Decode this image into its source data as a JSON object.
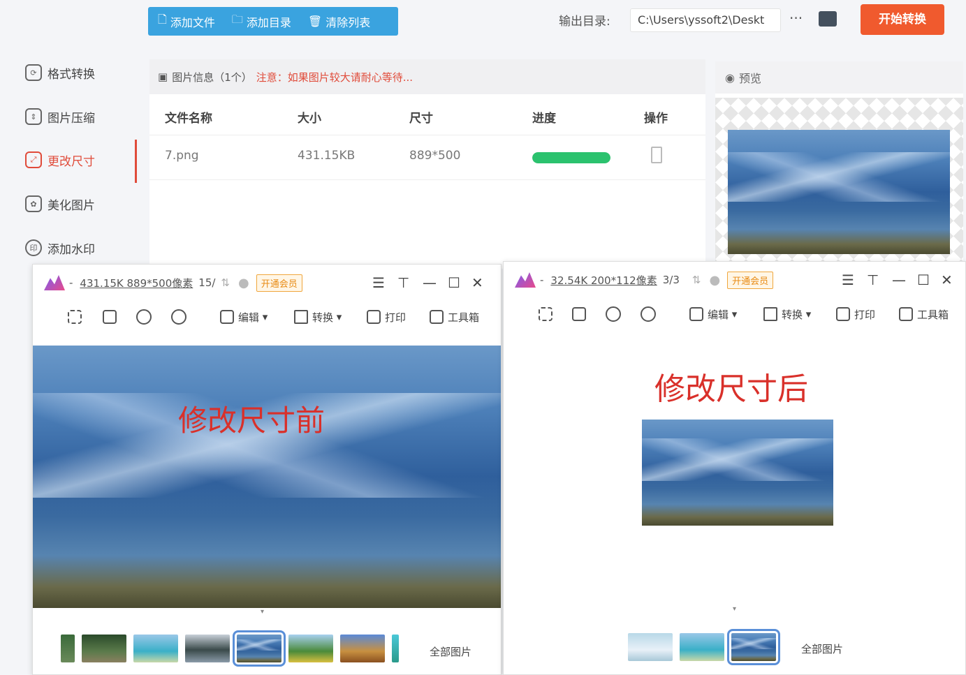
{
  "toolbar": {
    "add_file": "添加文件",
    "add_dir": "添加目录",
    "clear_list": "清除列表",
    "output_label": "输出目录:",
    "output_path": "C:\\Users\\yssoft2\\Deskt",
    "more": "···",
    "start": "开始转换"
  },
  "sidebar": {
    "items": [
      {
        "label": "格式转换",
        "icon": "format-convert-icon"
      },
      {
        "label": "图片压缩",
        "icon": "compress-icon"
      },
      {
        "label": "更改尺寸",
        "icon": "resize-icon"
      },
      {
        "label": "美化图片",
        "icon": "beautify-icon"
      },
      {
        "label": "添加水印",
        "icon": "watermark-icon"
      }
    ],
    "active_index": 2
  },
  "file_panel": {
    "header": "图片信息（1个）",
    "warn": "注意：如果图片较大请耐心等待...",
    "columns": [
      "文件名称",
      "大小",
      "尺寸",
      "进度",
      "操作"
    ],
    "rows": [
      {
        "name": "7.png",
        "size": "431.15KB",
        "dims": "889*500",
        "progress": 1.0
      }
    ]
  },
  "preview": {
    "title": "预览"
  },
  "viewer_left": {
    "dash": "-",
    "info": "431.15K 889*500像素",
    "count": "15/",
    "vip": "开通会员",
    "tools": {
      "edit": "编辑",
      "convert": "转换",
      "print": "打印",
      "toolbox": "工具箱"
    },
    "caption": "修改尺寸前",
    "all_images": "全部图片"
  },
  "viewer_right": {
    "dash": "-",
    "info": "32.54K 200*112像素",
    "count": "3/3",
    "vip": "开通会员",
    "tools": {
      "edit": "编辑",
      "convert": "转换",
      "print": "打印",
      "toolbox": "工具箱"
    },
    "caption": "修改尺寸后",
    "all_images": "全部图片"
  },
  "colors": {
    "accent": "#3aa3df",
    "start": "#f05a2e",
    "active": "#e04b3a",
    "progress": "#2bc26e",
    "caption": "#d9302a"
  }
}
